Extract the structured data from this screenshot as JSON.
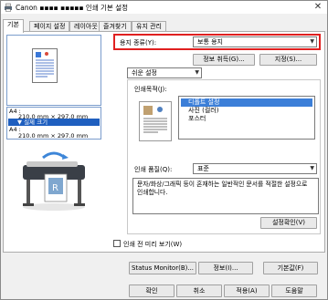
{
  "titlebar": {
    "title": "Canon ▪▪▪▪ ▪▪▪▪▪ 인쇄 기본 설정",
    "close": "✕"
  },
  "tabs": [
    {
      "label": "기본"
    },
    {
      "label": "페이지 설정"
    },
    {
      "label": "레이아웃"
    },
    {
      "label": "즐겨찾기"
    },
    {
      "label": "유지 관리"
    }
  ],
  "preview": {
    "size_line1": "A4 :",
    "size_line2": "210.0 mm × 297.0 mm",
    "size_selected": "▼ 실제 크기",
    "size_line3": "A4 :",
    "size_line4": "210.0 mm × 297.0 mm"
  },
  "media": {
    "label": "용지 종류(Y):",
    "value": "보통 용지"
  },
  "buttons": {
    "get_info": "정보 취득(G)...",
    "specify": "지정(S)...",
    "quality_confirm": "설정확인(V)",
    "status_monitor": "Status Monitor(B)...",
    "info": "정보(I)...",
    "defaults": "기본값(F)",
    "ok": "확인",
    "cancel": "취소",
    "apply": "적용(A)",
    "help": "도움말"
  },
  "easy_setup": {
    "value": "쉬운 설정"
  },
  "purpose": {
    "label": "인쇄목적(J):",
    "items": [
      "디폴트 설정",
      "사진 (컬러)",
      "포스터"
    ],
    "selected_index": 0
  },
  "quality": {
    "label": "인쇄 품질(Q):",
    "value": "표준"
  },
  "description": "문자/화상/그래픽 등이 혼재하는 일반적인 문서를 적절한 설정으로 인쇄합니다.",
  "preview_before_print": {
    "label": "인쇄 전 미리 보기(W)",
    "checked": false
  },
  "colors": {
    "highlight": "#e02020",
    "selection": "#3c7fd8"
  }
}
